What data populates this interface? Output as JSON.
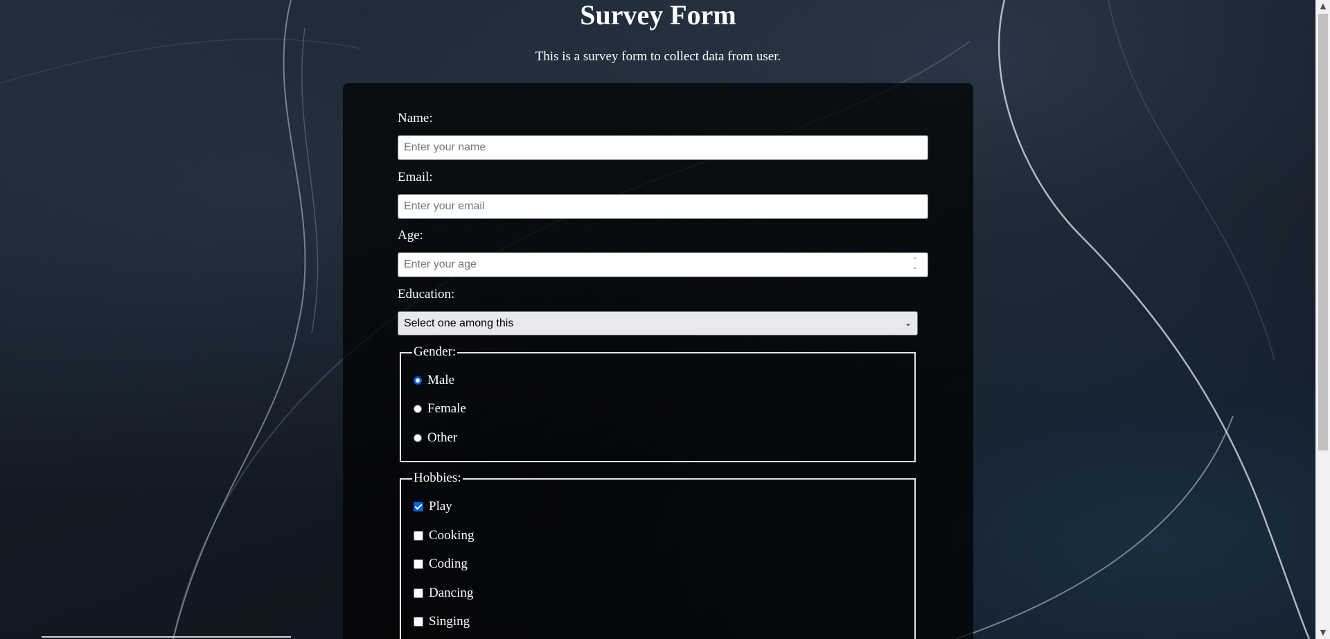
{
  "page": {
    "title": "Survey Form",
    "description": "This is a survey form to collect data from user."
  },
  "fields": {
    "name": {
      "label": "Name:",
      "placeholder": "Enter your name",
      "value": ""
    },
    "email": {
      "label": "Email:",
      "placeholder": "Enter your email",
      "value": ""
    },
    "age": {
      "label": "Age:",
      "placeholder": "Enter your age",
      "value": ""
    },
    "education": {
      "label": "Education:",
      "selected": "Select one among this"
    }
  },
  "gender": {
    "legend": "Gender:",
    "options": [
      {
        "label": "Male",
        "checked": true
      },
      {
        "label": "Female",
        "checked": false
      },
      {
        "label": "Other",
        "checked": false
      }
    ]
  },
  "hobbies": {
    "legend": "Hobbies:",
    "options": [
      {
        "label": "Play",
        "checked": true
      },
      {
        "label": "Cooking",
        "checked": false
      },
      {
        "label": "Coding",
        "checked": false
      },
      {
        "label": "Dancing",
        "checked": false
      },
      {
        "label": "Singing",
        "checked": false
      }
    ]
  },
  "icons": {
    "select_chevron": "chevron-down-icon",
    "spinner": "number-spinner-icon",
    "scroll_up": "scroll-up-arrow-icon",
    "scroll_down": "scroll-down-arrow-icon"
  },
  "colors": {
    "accent": "#0060df",
    "panel": "#000000",
    "text": "#ffffff"
  }
}
